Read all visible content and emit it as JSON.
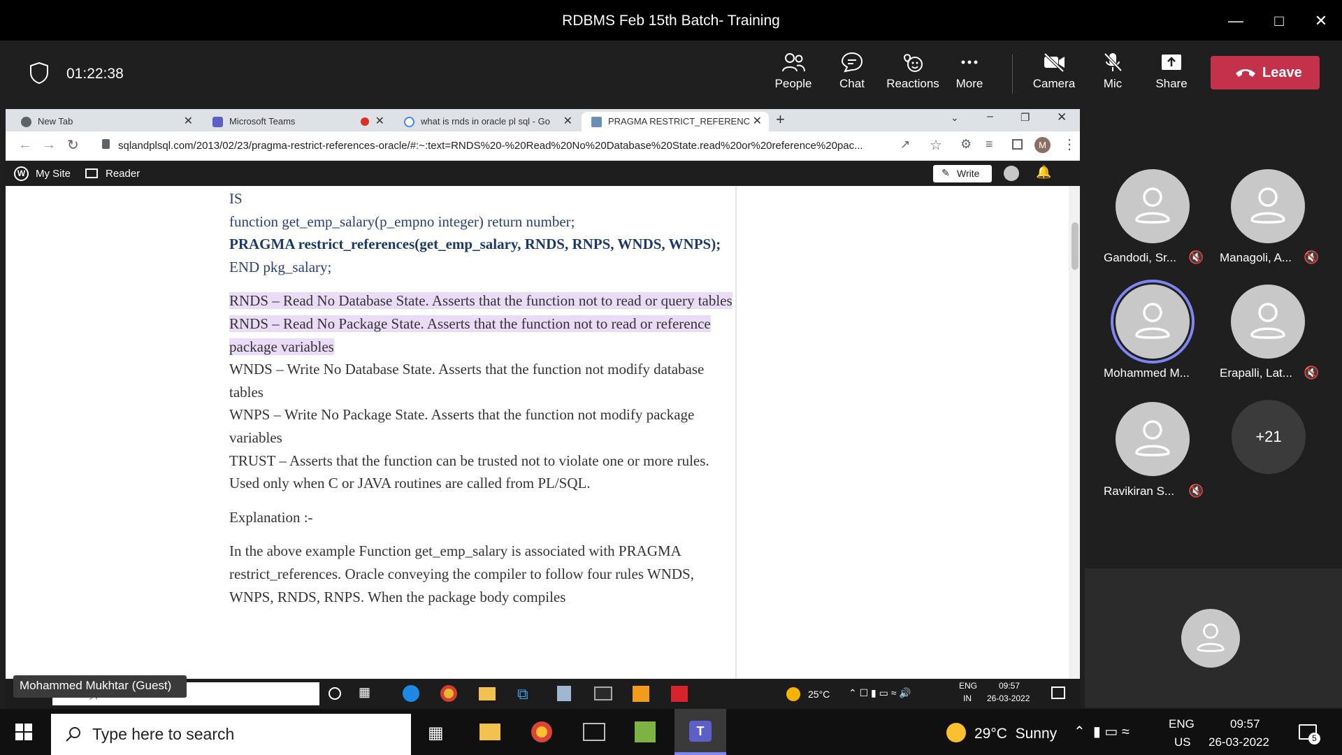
{
  "window": {
    "title": "RDBMS Feb 15th Batch- Training"
  },
  "meeting": {
    "timer": "01:22:38",
    "buttons": {
      "people": "People",
      "chat": "Chat",
      "reactions": "Reactions",
      "more": "More",
      "camera": "Camera",
      "mic": "Mic",
      "share": "Share",
      "leave": "Leave"
    }
  },
  "browser": {
    "tabs": [
      {
        "label": "New Tab"
      },
      {
        "label": "Microsoft Teams"
      },
      {
        "label": "what is rnds in oracle pl sql - Go"
      },
      {
        "label": "PRAGMA RESTRICT_REFERENCES"
      }
    ],
    "url": "sqlandplsql.com/2013/02/23/pragma-restrict-references-oracle/#:~:text=RNDS%20-%20Read%20No%20Database%20State.read%20or%20reference%20pac...",
    "wp_bar": {
      "my_site": "My Site",
      "reader": "Reader",
      "write": "Write"
    },
    "profile_initial": "M"
  },
  "article": {
    "code": [
      "IS",
      "function get_emp_salary(p_empno integer) return number;",
      "PRAGMA restrict_references(get_emp_salary, RNDS, RNPS, WNDS, WNPS);",
      "END pkg_salary;"
    ],
    "rules": [
      "RNDS – Read No Database State. Asserts that the function not to read or query tables",
      "RNDS – Read No Package State. Asserts that the function not to read or reference package variables",
      "WNDS – Write No Database State. Asserts that the function not modify database tables",
      "WNPS – Write No Package State. Asserts that the function not modify package variables",
      "TRUST – Asserts that the function can be trusted not to violate one or more rules. Used only when C or JAVA routines are called from PL/SQL."
    ],
    "explanation_heading": "Explanation :-",
    "explanation": "In the above example Function get_emp_salary is associated with PRAGMA restrict_references. Oracle conveying the compiler to follow four rules WNDS, WNPS, RNDS, RNPS. When the package body compiles"
  },
  "inner_taskbar": {
    "guest_label": "Mohammed Mukhtar (Guest)",
    "search_placeholder": "Type here to search",
    "weather": "25°C",
    "lang1": "ENG",
    "lang2": "IN",
    "time": "09:57",
    "date": "26-03-2022"
  },
  "participants": [
    {
      "name": "Gandodi, Sr...",
      "muted": true
    },
    {
      "name": "Managoli, A...",
      "muted": true
    },
    {
      "name": "Mohammed M...",
      "muted": false,
      "speaking": true
    },
    {
      "name": "Erapalli, Lat...",
      "muted": true
    },
    {
      "name": "Ravikiran S...",
      "muted": true
    }
  ],
  "more_participants": "+21",
  "taskbar": {
    "search_placeholder": "Type here to search",
    "weather": "29°C  Sunny",
    "lang1": "ENG",
    "lang2": "US",
    "time": "09:57",
    "date": "26-03-2022",
    "notifications": "5"
  },
  "colors": {
    "leave": "#c4314b",
    "highlight": "#eadcf6",
    "speaking_ring": "#7f85f5"
  }
}
